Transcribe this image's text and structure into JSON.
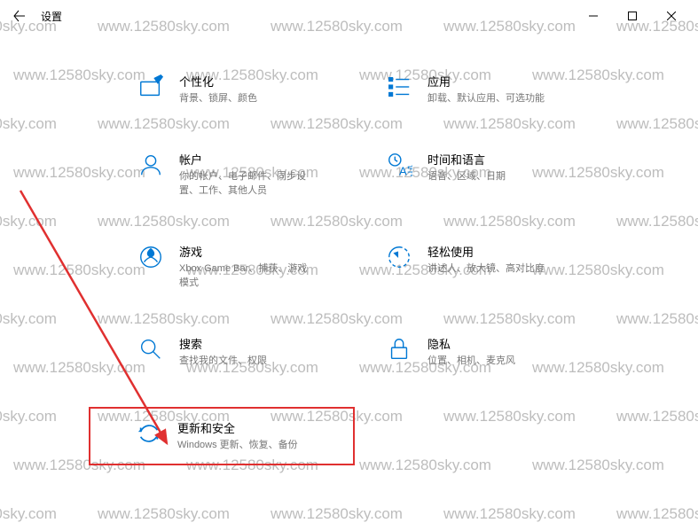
{
  "window": {
    "title": "设置"
  },
  "watermark": {
    "text": "www.12580sky.com"
  },
  "settings": {
    "personalization": {
      "title": "个性化",
      "desc": "背景、锁屏、颜色"
    },
    "apps": {
      "title": "应用",
      "desc": "卸载、默认应用、可选功能"
    },
    "accounts": {
      "title": "帐户",
      "desc": "你的帐户、电子邮件、同步设置、工作、其他人员"
    },
    "time_language": {
      "title": "时间和语言",
      "desc": "语音、区域、日期"
    },
    "gaming": {
      "title": "游戏",
      "desc": "Xbox Game Bar、捕获、游戏模式"
    },
    "ease_of_access": {
      "title": "轻松使用",
      "desc": "讲述人、放大镜、高对比度"
    },
    "search": {
      "title": "搜索",
      "desc": "查找我的文件、权限"
    },
    "privacy": {
      "title": "隐私",
      "desc": "位置、相机、麦克风"
    },
    "update_security": {
      "title": "更新和安全",
      "desc": "Windows 更新、恢复、备份"
    }
  },
  "annotation": {
    "highlight_color": "#e03030"
  }
}
